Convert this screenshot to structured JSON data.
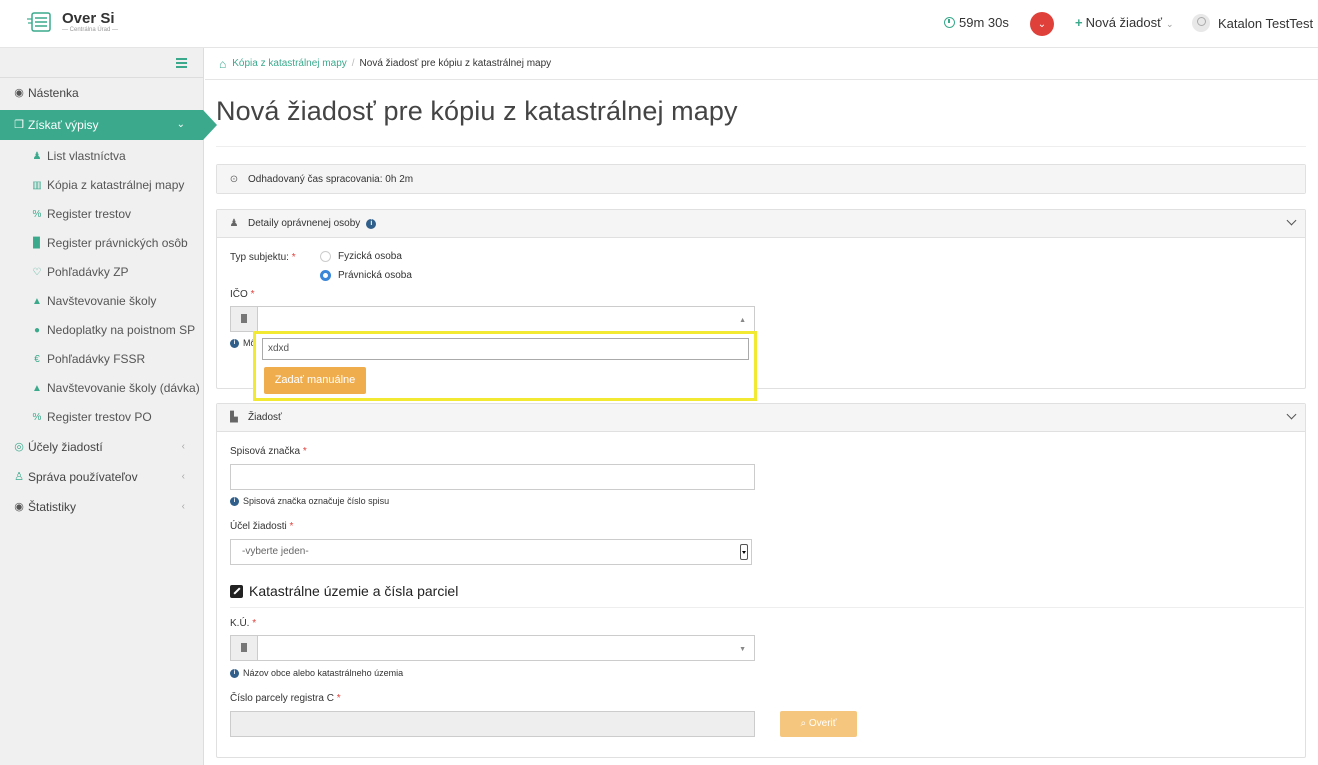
{
  "app": {
    "name": "Over Si",
    "subtitle": "— Centrálna Úrad —"
  },
  "header": {
    "timer": "59m 30s",
    "new_request_label": "Nová žiadosť",
    "user_name": "Katalon TestTest"
  },
  "sidebar": {
    "items": [
      {
        "label": "Nástenka",
        "icon": "dashboard-icon"
      },
      {
        "label": "Získať výpisy",
        "icon": "copy-icon",
        "active": true
      },
      {
        "label": "Účely žiadostí",
        "icon": "target-icon"
      },
      {
        "label": "Správa používateľov",
        "icon": "users-icon"
      },
      {
        "label": "Štatistiky",
        "icon": "stats-icon"
      }
    ],
    "subitems": [
      {
        "label": "List vlastníctva",
        "icon": "people-icon"
      },
      {
        "label": "Kópia z katastrálnej mapy",
        "icon": "map-icon"
      },
      {
        "label": "Register trestov",
        "icon": "percent-icon"
      },
      {
        "label": "Register právnických osôb",
        "icon": "building-icon"
      },
      {
        "label": "Pohľadávky ZP",
        "icon": "stethoscope-icon"
      },
      {
        "label": "Navštevovanie školy",
        "icon": "graduation-cap-icon"
      },
      {
        "label": "Nedoplatky na poistnom SP",
        "icon": "globe-icon"
      },
      {
        "label": "Pohľadávky FSSR",
        "icon": "euro-icon"
      },
      {
        "label": "Navštevovanie školy (dávka)",
        "icon": "graduation-cap-icon"
      },
      {
        "label": "Register trestov PO",
        "icon": "percent-icon"
      }
    ]
  },
  "breadcrumb": {
    "link": "Kópia z katastrálnej mapy",
    "current": "Nová žiadosť pre kópiu z katastrálnej mapy"
  },
  "page": {
    "title": "Nová žiadosť pre kópiu z katastrálnej mapy"
  },
  "processing": {
    "label": "Odhadovaný čas spracovania: 0h 2m"
  },
  "person_panel": {
    "title": "Detaily oprávnenej osoby",
    "subject_type_label": "Typ subjektu:",
    "options": [
      "Fyzická osoba",
      "Právnická osoba"
    ],
    "selected": "Právnická osoba",
    "ico_label": "IČO",
    "hint_partial": "Mô",
    "dropdown": {
      "search_value": "xdxd",
      "manual_button": "Zadať manuálne"
    }
  },
  "request_panel": {
    "title": "Žiadosť",
    "case_label": "Spisová značka",
    "case_hint": "Spisová značka označuje číslo spisu",
    "purpose_label": "Účel žiadosti",
    "purpose_value": "-vyberte jeden-",
    "section_title": "Katastrálne územie a čísla parciel",
    "ku_label": "K.Ú.",
    "ku_hint": "Názov obce alebo katastrálneho územia",
    "parcel_label": "Číslo parcely registra C",
    "verify_button": "Overiť"
  },
  "colors": {
    "accent": "#3aa98c",
    "warning": "#f0ad4e",
    "danger": "#e0403a",
    "highlight": "#f2ea32"
  }
}
